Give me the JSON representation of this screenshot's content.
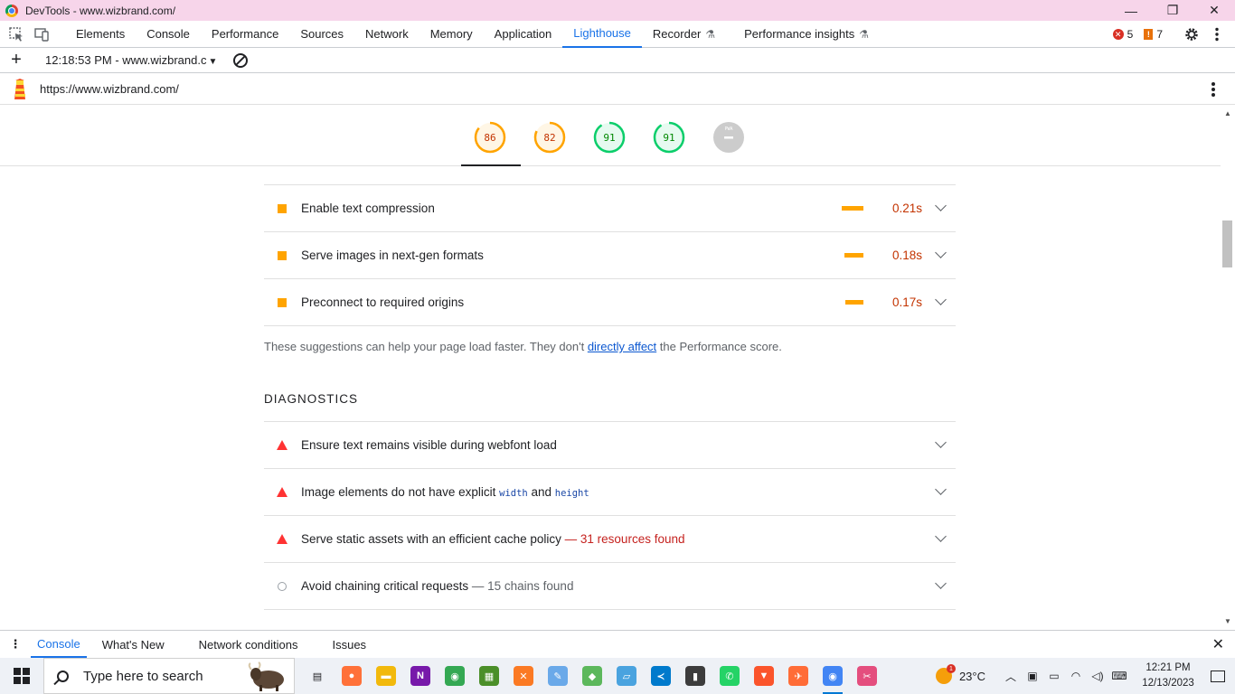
{
  "window": {
    "title": "DevTools - www.wizbrand.com/",
    "minimize": "—",
    "restore": "❐",
    "close": "✕"
  },
  "devtools_tabs": [
    {
      "label": "Elements"
    },
    {
      "label": "Console"
    },
    {
      "label": "Performance"
    },
    {
      "label": "Sources"
    },
    {
      "label": "Network"
    },
    {
      "label": "Memory"
    },
    {
      "label": "Application"
    },
    {
      "label": "Lighthouse",
      "active": true
    },
    {
      "label": "Recorder",
      "experimental": true
    },
    {
      "label": "Performance insights",
      "experimental": true
    }
  ],
  "status": {
    "errors": "5",
    "warnings": "7"
  },
  "lighthouse_toolbar": {
    "add": "+",
    "report_select": "12:18:53 PM - www.wizbrand.c"
  },
  "report": {
    "url": "https://www.wizbrand.com/"
  },
  "scores": [
    {
      "value": "86",
      "fraction": 0.86,
      "color": "#ffa400",
      "text_color": "#c33300"
    },
    {
      "value": "82",
      "fraction": 0.82,
      "color": "#ffa400",
      "text_color": "#c33300"
    },
    {
      "value": "91",
      "fraction": 0.91,
      "color": "#0cce6b",
      "text_color": "#008800"
    },
    {
      "value": "91",
      "fraction": 0.91,
      "color": "#0cce6b",
      "text_color": "#008800"
    },
    {
      "value": "PWA",
      "fraction": 0,
      "color": "#cccccc",
      "text_color": "#ffffff"
    }
  ],
  "opportunities": [
    {
      "label": "Enable text compression",
      "savings": "0.21s",
      "bar_fraction": 0.21
    },
    {
      "label": "Serve images in next-gen formats",
      "savings": "0.18s",
      "bar_fraction": 0.18
    },
    {
      "label": "Preconnect to required origins",
      "savings": "0.17s",
      "bar_fraction": 0.17
    }
  ],
  "note": {
    "before": "These suggestions can help your page load faster. They don't ",
    "link": "directly affect",
    "after": " the Performance score."
  },
  "diagnostics": {
    "heading": "DIAGNOSTICS",
    "items": [
      {
        "label": "Ensure text remains visible during webfont load"
      },
      {
        "label_a": "Image elements do not have explicit ",
        "code1": "width",
        "label_b": " and ",
        "code2": "height"
      },
      {
        "label": "Serve static assets with an efficient cache policy",
        "detail": "31 resources found",
        "sep": " — "
      },
      {
        "label": "Avoid chaining critical requests",
        "detail": "15 chains found",
        "sep": " — "
      }
    ]
  },
  "drawer": {
    "tabs": [
      {
        "label": "Console",
        "active": true
      },
      {
        "label": "What's New"
      },
      {
        "label": "Network conditions"
      },
      {
        "label": "Issues"
      }
    ]
  },
  "taskbar": {
    "search_placeholder": "Type here to search",
    "weather": "23°C",
    "weather_badge": "1",
    "time": "12:21 PM",
    "date": "12/13/2023",
    "apps": [
      {
        "name": "task-view-icon",
        "color": "#202124",
        "glyph": "▤"
      },
      {
        "name": "firefox-icon",
        "color": "#ff7139",
        "glyph": "●"
      },
      {
        "name": "file-explorer-icon",
        "color": "#f2b90c",
        "glyph": "▬"
      },
      {
        "name": "onenote-icon",
        "color": "#7719aa",
        "glyph": "N"
      },
      {
        "name": "chrome-icon",
        "color": "#34a853",
        "glyph": "◉"
      },
      {
        "name": "notepad-icon",
        "color": "#4b8f29",
        "glyph": "▦"
      },
      {
        "name": "xampp-icon",
        "color": "#fb7a24",
        "glyph": "✕"
      },
      {
        "name": "paint-icon",
        "color": "#6aa9e9",
        "glyph": "✎"
      },
      {
        "name": "git-icon",
        "color": "#5cb85c",
        "glyph": "◆"
      },
      {
        "name": "files-icon",
        "color": "#4aa3df",
        "glyph": "▱"
      },
      {
        "name": "vscode-icon",
        "color": "#007acc",
        "glyph": "≺"
      },
      {
        "name": "terminal-icon",
        "color": "#3c3c3c",
        "glyph": "▮"
      },
      {
        "name": "whatsapp-icon",
        "color": "#25d366",
        "glyph": "✆"
      },
      {
        "name": "brave-icon",
        "color": "#fb542b",
        "glyph": "▼"
      },
      {
        "name": "postman-icon",
        "color": "#ff6c37",
        "glyph": "✈"
      },
      {
        "name": "chrome-active-icon",
        "color": "#4285f4",
        "glyph": "◉",
        "open": true
      },
      {
        "name": "snipping-tool-icon",
        "color": "#e44e7e",
        "glyph": "✂"
      }
    ]
  }
}
